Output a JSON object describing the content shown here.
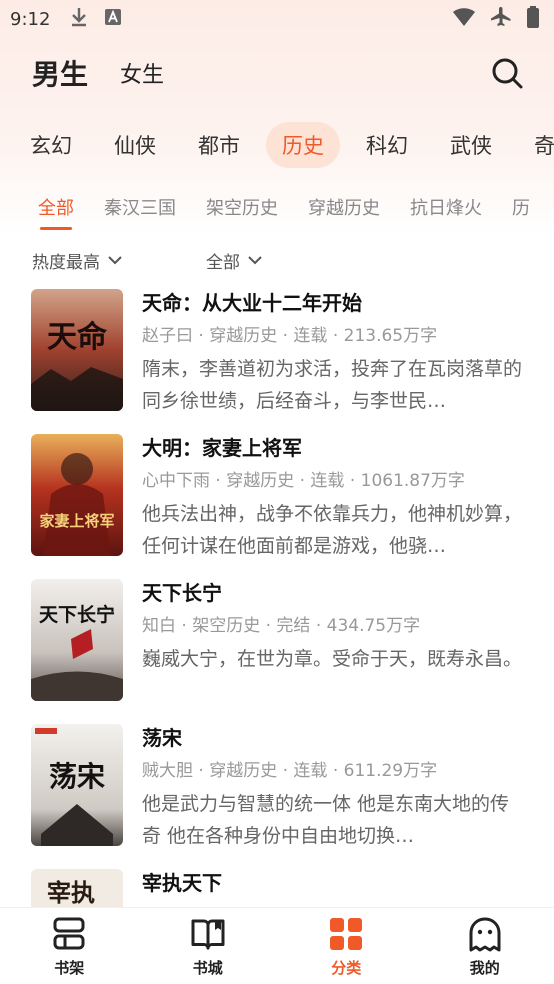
{
  "status_bar": {
    "time": "9:12",
    "left_icons": [
      "download-icon",
      "font-a-icon"
    ],
    "right_icons": [
      "wifi-icon",
      "airplane-icon",
      "battery-icon"
    ]
  },
  "gender_tabs": [
    {
      "label": "男生",
      "active": true
    },
    {
      "label": "女生",
      "active": false
    }
  ],
  "categories": [
    {
      "label": "玄幻",
      "active": false
    },
    {
      "label": "仙侠",
      "active": false
    },
    {
      "label": "都市",
      "active": false
    },
    {
      "label": "历史",
      "active": true
    },
    {
      "label": "科幻",
      "active": false
    },
    {
      "label": "武侠",
      "active": false
    },
    {
      "label": "奇",
      "active": false
    }
  ],
  "subcategories": [
    {
      "label": "全部",
      "active": true
    },
    {
      "label": "秦汉三国",
      "active": false
    },
    {
      "label": "架空历史",
      "active": false
    },
    {
      "label": "穿越历史",
      "active": false
    },
    {
      "label": "抗日烽火",
      "active": false
    },
    {
      "label": "历",
      "active": false
    }
  ],
  "filters": {
    "sort": "热度最高",
    "status": "全部"
  },
  "books": [
    {
      "title": "天命：从大业十二年开始",
      "meta": "赵子曰 · 穿越历史 · 连载 · 213.65万字",
      "desc": "隋末，李善道初为求活，投奔了在瓦岗落草的同乡徐世绩，后经奋斗，与李世民…",
      "cover_text": "天命",
      "cover_colors": [
        "#b64a35",
        "#3b2a26"
      ]
    },
    {
      "title": "大明：家妻上将军",
      "meta": "心中下雨 · 穿越历史 · 连载 · 1061.87万字",
      "desc": "他兵法出神，战争不依靠兵力，他神机妙算，任何计谋在他面前都是游戏，他骁…",
      "cover_text": "家妻上将军",
      "cover_colors": [
        "#8c1d17",
        "#e39a3a"
      ]
    },
    {
      "title": "天下长宁",
      "meta": "知白 · 架空历史 · 完结 · 434.75万字",
      "desc": "巍威大宁，在世为章。受命于天，既寿永昌。",
      "cover_text": "天下长宁",
      "cover_colors": [
        "#e8e5e2",
        "#b31f23"
      ]
    },
    {
      "title": "荡宋",
      "meta": "贼大胆 · 穿越历史 · 连载 · 611.29万字",
      "desc": "他是武力与智慧的统一体 他是东南大地的传奇 他在各种身份中自由地切换…",
      "cover_text": "荡宋",
      "cover_colors": [
        "#e6e3de",
        "#3b3632"
      ]
    },
    {
      "title": "宰执天下",
      "meta": "",
      "desc": "",
      "cover_text": "宰执",
      "cover_colors": [
        "#f1ebe3",
        "#8b5a3c"
      ]
    }
  ],
  "bottom_nav": [
    {
      "label": "书架",
      "icon": "bookshelf-icon",
      "active": false
    },
    {
      "label": "书城",
      "icon": "book-open-icon",
      "active": false
    },
    {
      "label": "分类",
      "icon": "grid-icon",
      "active": true
    },
    {
      "label": "我的",
      "icon": "profile-icon",
      "active": false
    }
  ],
  "colors": {
    "accent": "#f05a28",
    "accent_light": "#fde2d6"
  }
}
